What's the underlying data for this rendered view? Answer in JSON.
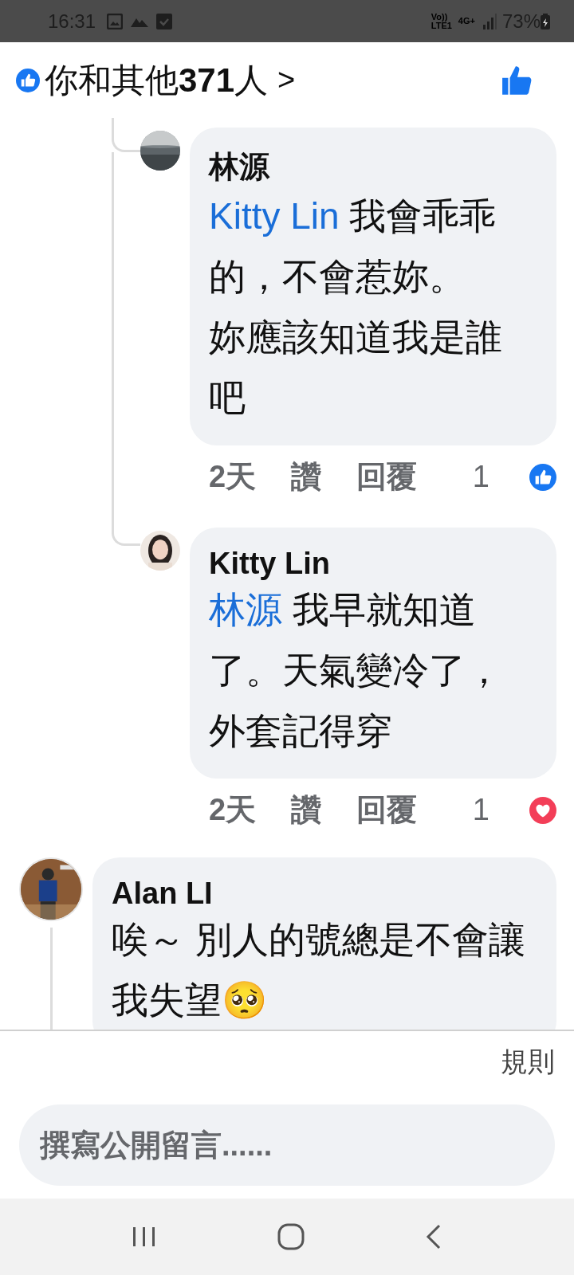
{
  "status_bar": {
    "time": "16:31",
    "volte": [
      "Vo))",
      "LTE1"
    ],
    "network": "4G+",
    "battery": "73%"
  },
  "reactions_header": {
    "text": "你和其他",
    "count": "371",
    "suffix": "人",
    "chevron": ">",
    "liked": true
  },
  "replies": [
    {
      "name": "林源",
      "mention": "Kitty Lin",
      "text": "我會乖乖的，不會惹妳。",
      "more_text": "妳應該知道我是誰吧",
      "time": "2天",
      "like_label": "讚",
      "reply_label": "回覆",
      "reaction_count": "1",
      "reaction": {
        "kind": "like"
      }
    },
    {
      "name": "Kitty Lin",
      "mention": "林源",
      "text": "我早就知道了。天氣變冷了，外套記得穿",
      "time": "2天",
      "like_label": "讚",
      "reply_label": "回覆",
      "reaction_count": "1",
      "reaction": {
        "kind": "love"
      }
    }
  ],
  "comment": {
    "name": "Alan LI",
    "text": "唉～ 別人的號總是不會讓我失望🥺"
  },
  "rules_link": "規則",
  "compose": {
    "placeholder": "撰寫公開留言......"
  }
}
